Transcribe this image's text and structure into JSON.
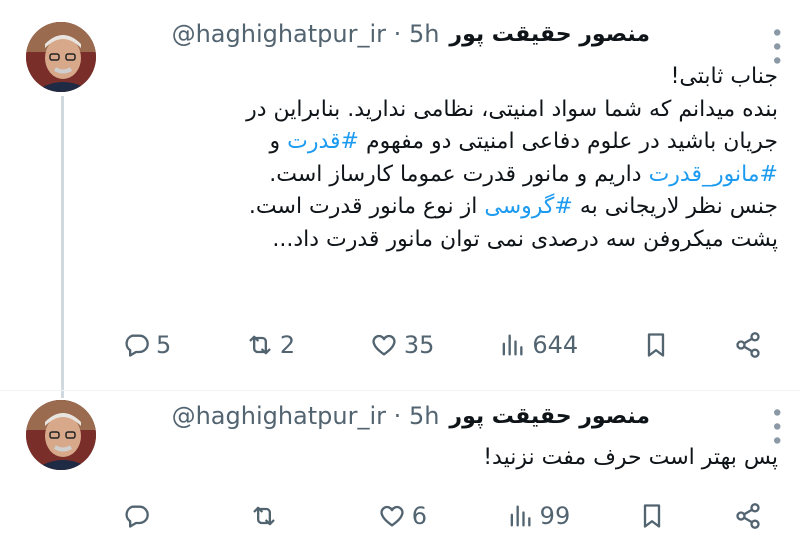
{
  "tweets": [
    {
      "author_name": "منصور حقیقت پور",
      "handle": "@haghighatpur_ir",
      "time": "5h",
      "text_lines": [
        [
          {
            "t": "جناب ثابتی!",
            "tag": false
          }
        ],
        [
          {
            "t": "بنده میدانم که شما سواد امنیتی، نظامی ندارید. بنابراین در",
            "tag": false
          }
        ],
        [
          {
            "t": "جریان باشید در علوم دفاعی امنیتی دو مفهوم ",
            "tag": false
          },
          {
            "t": "#قدرت",
            "tag": true
          },
          {
            "t": " و",
            "tag": false
          }
        ],
        [
          {
            "t": "#مانور_قدرت",
            "tag": true
          },
          {
            "t": " داریم و مانور قدرت عموما کارساز است.",
            "tag": false
          }
        ],
        [
          {
            "t": "جنس نظر لاریجانی به ",
            "tag": false
          },
          {
            "t": "#گروسی",
            "tag": true
          },
          {
            "t": " از نوع مانور قدرت است.",
            "tag": false
          }
        ],
        [
          {
            "t": "پشت میکروفن سه درصدی نمی توان مانور قدرت داد...",
            "tag": false
          }
        ]
      ],
      "replies": "5",
      "retweets": "2",
      "likes": "35",
      "views": "644"
    },
    {
      "author_name": "منصور حقیقت پور",
      "handle": "@haghighatpur_ir",
      "time": "5h",
      "text_lines": [
        [
          {
            "t": "پس بهتر است حرف مفت نزنید!",
            "tag": false
          }
        ]
      ],
      "replies": "",
      "retweets": "",
      "likes": "6",
      "views": "99"
    }
  ],
  "icons": {
    "reply": "reply-icon",
    "retweet": "retweet-icon",
    "like": "heart-icon",
    "views": "views-icon",
    "bookmark": "bookmark-icon",
    "share": "share-icon",
    "more": "more-icon"
  },
  "colors": {
    "hashtag": "#1d9bf0",
    "secondary": "#536471",
    "text": "#0f1419"
  }
}
